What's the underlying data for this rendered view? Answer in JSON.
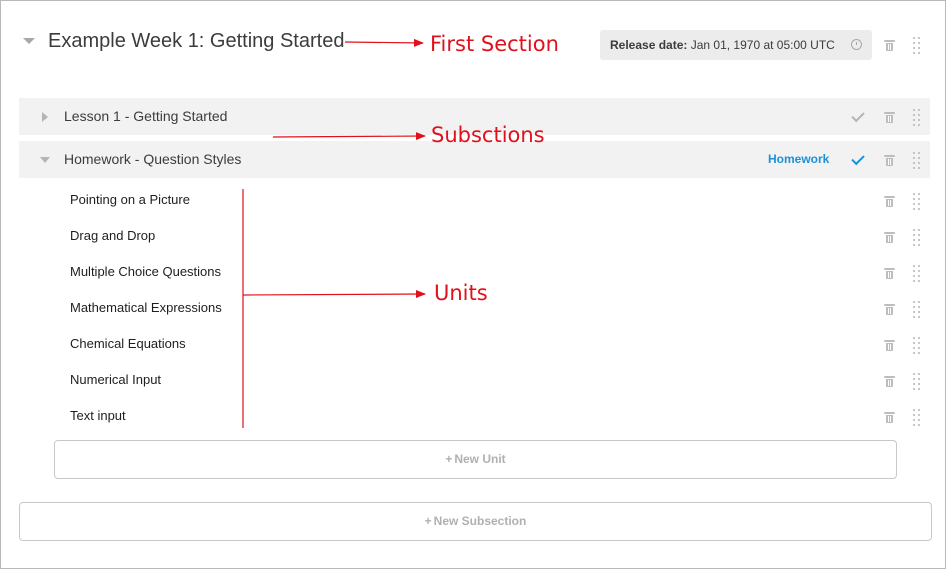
{
  "section": {
    "title": "Example Week 1: Getting Started",
    "release_label": "Release date:",
    "release_value": "Jan 01, 1970 at 05:00 UTC"
  },
  "subsections": [
    {
      "title": "Lesson 1 - Getting Started",
      "expanded": false,
      "badge": ""
    },
    {
      "title": "Homework - Question Styles",
      "expanded": true,
      "badge": "Homework"
    }
  ],
  "units": [
    "Pointing on a Picture",
    "Drag and Drop",
    "Multiple Choice Questions",
    "Mathematical Expressions",
    "Chemical Equations",
    "Numerical Input",
    "Text input"
  ],
  "buttons": {
    "plus": "+",
    "new_unit": "New Unit",
    "new_subsection": "New Subsection"
  },
  "annotations": {
    "first_section": "First Section",
    "subsections": "Subsctions",
    "units": "Units"
  },
  "icons": [
    "chevron-down-icon",
    "chevron-right-icon",
    "clock-icon",
    "trash-icon",
    "drag-handle-icon",
    "check-icon"
  ],
  "colors": {
    "accent": "#1e90d6",
    "annotation": "#e0101c",
    "bar": "#f2f2f2",
    "release_bg": "#ececec"
  }
}
